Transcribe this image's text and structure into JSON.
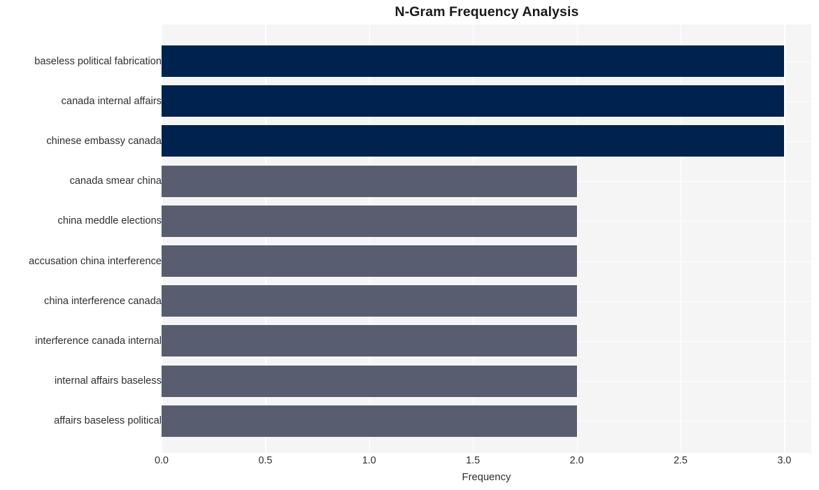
{
  "chart_data": {
    "type": "bar",
    "orientation": "horizontal",
    "title": "N-Gram Frequency Analysis",
    "xlabel": "Frequency",
    "ylabel": "",
    "categories": [
      "baseless political fabrication",
      "canada internal affairs",
      "chinese embassy canada",
      "canada smear china",
      "china meddle elections",
      "accusation china interference",
      "china interference canada",
      "interference canada internal",
      "internal affairs baseless",
      "affairs baseless political"
    ],
    "values": [
      3,
      3,
      3,
      2,
      2,
      2,
      2,
      2,
      2,
      2
    ],
    "bar_colors": [
      "#00224e",
      "#00224e",
      "#00224e",
      "#585e70",
      "#585e70",
      "#585e70",
      "#585e70",
      "#585e70",
      "#585e70",
      "#585e70"
    ],
    "xlim": [
      0.0,
      3.13
    ],
    "xticks": [
      "0.0",
      "0.5",
      "1.0",
      "1.5",
      "2.0",
      "2.5",
      "3.0"
    ],
    "xtick_values": [
      0.0,
      0.5,
      1.0,
      1.5,
      2.0,
      2.5,
      3.0
    ],
    "grid": true,
    "grid_color": "#ffffff",
    "plot_background": "#f5f5f6",
    "figure_background": "#ffffff",
    "legend": null
  }
}
